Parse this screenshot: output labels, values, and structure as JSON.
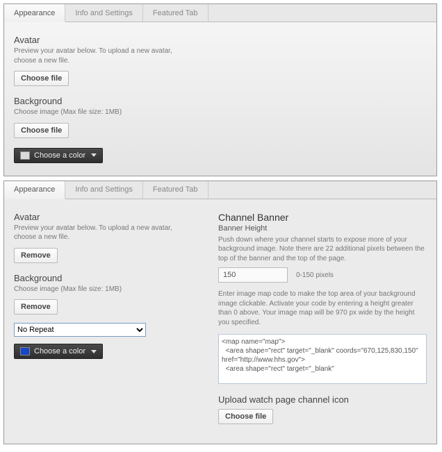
{
  "tabs": {
    "appearance": "Appearance",
    "info": "Info and Settings",
    "featured": "Featured Tab"
  },
  "panel1": {
    "avatar": {
      "title": "Avatar",
      "hint": "Preview your avatar below. To upload a new avatar, choose a new file.",
      "choose": "Choose file"
    },
    "background": {
      "title": "Background",
      "hint": "Choose image (Max file size: 1MB)",
      "choose": "Choose file",
      "color_label": "Choose a color",
      "swatch": "#d9d9d9"
    }
  },
  "panel2": {
    "avatar": {
      "title": "Avatar",
      "hint": "Preview your avatar below. To upload a new avatar, choose a new file.",
      "remove": "Remove"
    },
    "background": {
      "title": "Background",
      "hint": "Choose image (Max file size: 1MB)",
      "remove": "Remove",
      "repeat_option": "No Repeat",
      "color_label": "Choose a color",
      "swatch": "#1548c4"
    },
    "banner": {
      "title": "Channel Banner",
      "sub": "Banner Height",
      "hint1": "Push down where your channel starts to expose more of your background image. Note there are 22 additional pixels between the top of the banner and the top of the page.",
      "value": "150",
      "range": "0-150 pixels",
      "hint2": "Enter image map code to make the top area of your background image clickable. Activate your code by entering a height greater than 0 above. Your image map will be 970 px wide by the height you specified.",
      "map_code": "<map name=\"map\">\n  <area shape=\"rect\" target=\"_blank\" coords=\"670,125,830,150\" href=\"http://www.hhs.gov\">\n  <area shape=\"rect\" target=\"_blank\"",
      "upload_title": "Upload watch page channel icon",
      "choose": "Choose file"
    }
  }
}
